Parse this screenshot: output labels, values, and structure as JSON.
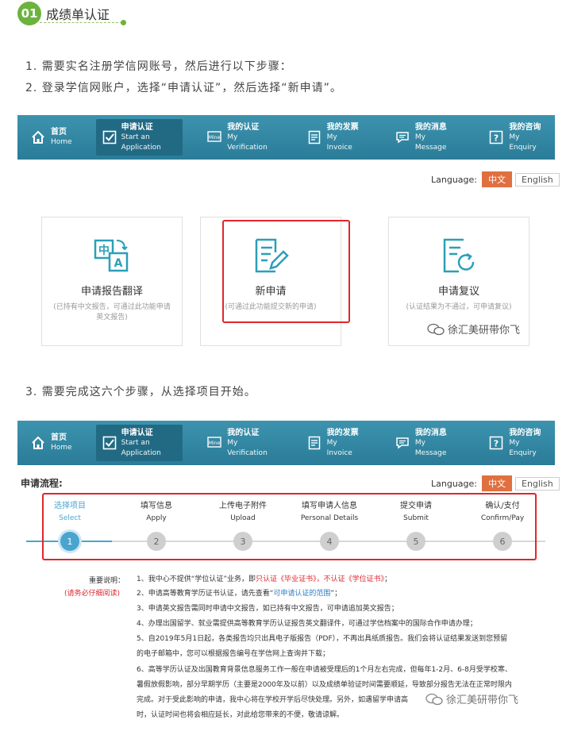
{
  "section": {
    "num": "01",
    "title": "成绩单认证"
  },
  "steps_text": {
    "s1": "1. 需要实名注册学信网账号，然后进行以下步骤：",
    "s2": "2. 登录学信网账户，选择“申请认证”，然后选择“新申请”。",
    "s3": "3. 需要完成这六个步骤，从选择项目开始。"
  },
  "nav": {
    "items": [
      {
        "cn": "首页",
        "en": "Home",
        "icon": "home-icon"
      },
      {
        "cn": "申请认证",
        "en": "Start an Application",
        "icon": "check-icon"
      },
      {
        "cn": "我的认证",
        "en": "My Verification",
        "icon": "mine-icon"
      },
      {
        "cn": "我的发票",
        "en": "My Invoice",
        "icon": "invoice-icon"
      },
      {
        "cn": "我的消息",
        "en": "My Message",
        "icon": "message-icon"
      },
      {
        "cn": "我的咨询",
        "en": "My Enquiry",
        "icon": "question-icon"
      }
    ]
  },
  "language": {
    "label": "Language:",
    "cn": "中文",
    "en": "English"
  },
  "cards": [
    {
      "title": "申请报告翻译",
      "desc": "(已持有中文报告，可通过此功能申请英文报告)",
      "icon": "translate-icon"
    },
    {
      "title": "新申请",
      "desc": "(可通过此功能提交新的申请)",
      "icon": "new-application-icon"
    },
    {
      "title": "申请复议",
      "desc": "(认证结果为不通过，可申请复议)",
      "icon": "review-icon"
    }
  ],
  "watermark": "徐汇美研带你飞",
  "process": {
    "label": "申请流程:",
    "steps": [
      {
        "cn": "选择项目",
        "en": "Select",
        "n": "1"
      },
      {
        "cn": "填写信息",
        "en": "Apply",
        "n": "2"
      },
      {
        "cn": "上传电子附件",
        "en": "Upload",
        "n": "3"
      },
      {
        "cn": "填写申请人信息",
        "en": "Personal Details",
        "n": "4"
      },
      {
        "cn": "提交申请",
        "en": "Submit",
        "n": "5"
      },
      {
        "cn": "确认/支付",
        "en": "Confirm/Pay",
        "n": "6"
      }
    ]
  },
  "notes": {
    "title": "重要说明：",
    "warn": "(请务必仔细阅读)",
    "n1a": "1、我中心不提供“学位认证”业务，即",
    "n1b": "只认证《毕业证书》，不认证《学位证书》",
    "n1c": "；",
    "n2a": "2、申请高等教育学历证书认证，请先查看“",
    "n2b": "可申请认证的范围",
    "n2c": "”；",
    "n3": "3、申请英文报告需同时申请中文报告，如已持有中文报告，可申请追加英文报告；",
    "n4": "4、办理出国留学、就业需提供高等教育学历认证报告英文翻译件，可通过学信档案中的国际合作申请办理；",
    "n5a": "5、自2019年5月1日起，各类报告均只出具电子版报告（PDF），不再出具纸质报告。我们会将认证结果发送到您预留",
    "n5b": "的电子邮箱中，您可以根据报告编号在学信网上查询并下载；",
    "n6a": "6、高等学历认证及出国教育背景信息服务工作一般在申请被受理后的1个月左右完成，但每年1-2月、6-8月受学校寒、",
    "n6b": "暑假放假影响，部分早期学历（主要是2000年及以前）以及成绩单验证时间需要顺延，导致部分报告无法在正常时限内",
    "n6c": "完成。对于受此影响的申请，我中心将在学校开学后尽快处理。另外，如遇留学申请高",
    "n6d": "时，认证时间也将会相应延长，对此给您带来的不便，敬请谅解。"
  }
}
